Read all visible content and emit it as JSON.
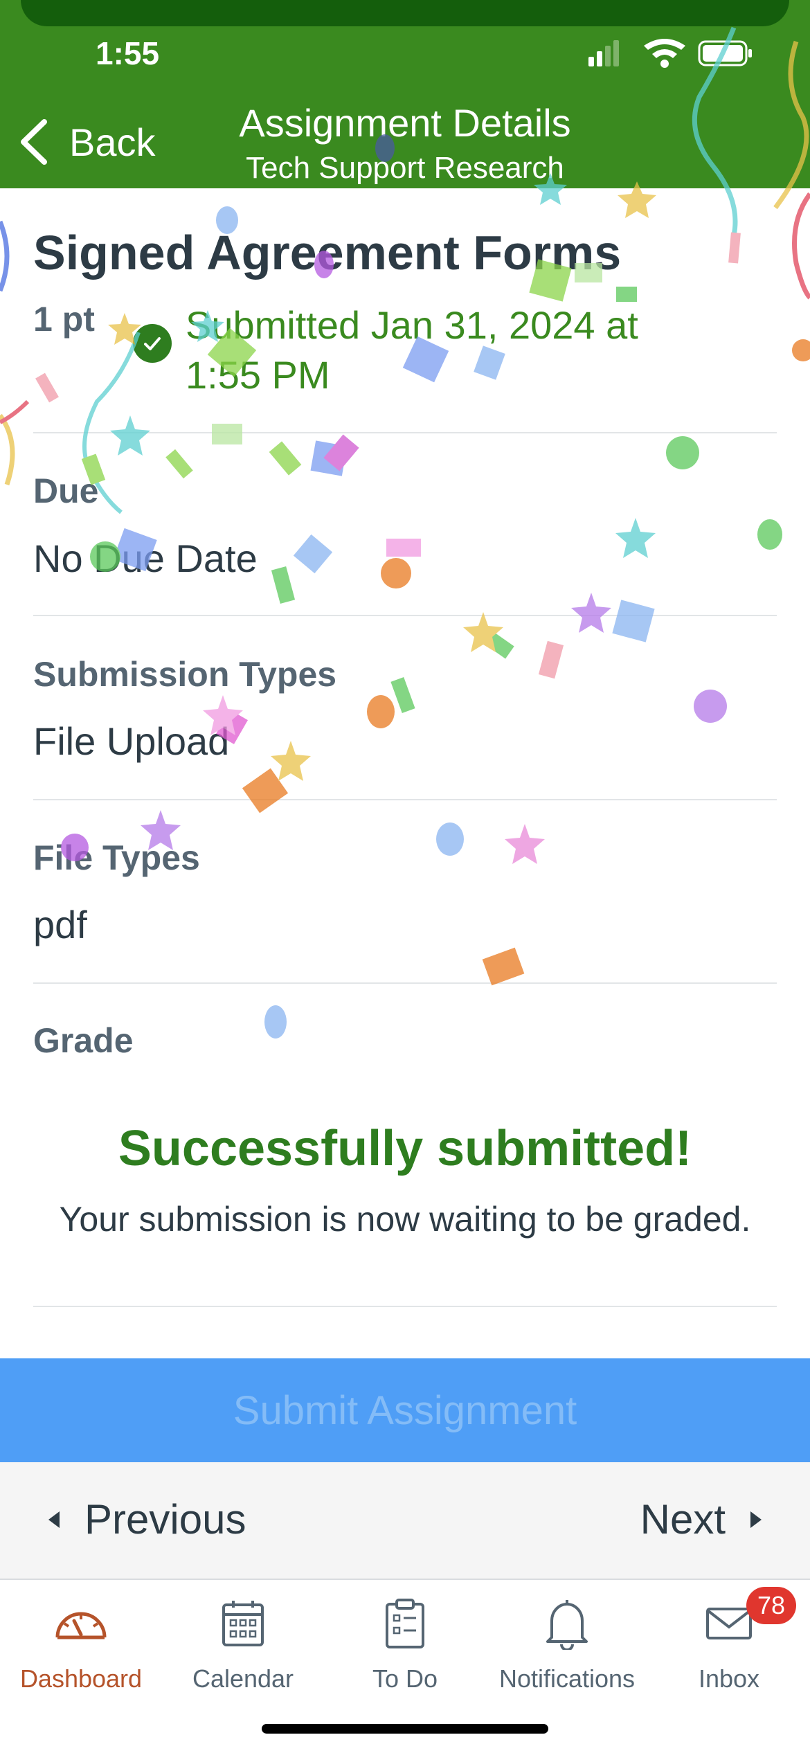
{
  "status_bar": {
    "time": "1:55"
  },
  "header": {
    "back_label": "Back",
    "title": "Assignment Details",
    "subtitle": "Tech Support Research"
  },
  "assignment": {
    "title": "Signed Agreement Forms",
    "points": "1 pt",
    "submitted_status": "Submitted Jan 31, 2024 at 1:55 PM"
  },
  "details": {
    "due_label": "Due",
    "due_value": "No Due Date",
    "submission_types_label": "Submission Types",
    "submission_types_value": "File Upload",
    "file_types_label": "File Types",
    "file_types_value": "pdf",
    "grade_label": "Grade"
  },
  "success": {
    "title": "Successfully submitted!",
    "message": "Your submission is now waiting to be graded."
  },
  "submit_button": {
    "label": "Submit Assignment"
  },
  "pager": {
    "previous_label": "Previous",
    "next_label": "Next"
  },
  "tabbar": {
    "items": [
      {
        "label": "Dashboard",
        "icon": "dashboard-gauge-icon",
        "active": true
      },
      {
        "label": "Calendar",
        "icon": "calendar-icon",
        "active": false
      },
      {
        "label": "To Do",
        "icon": "todo-clipboard-icon",
        "active": false
      },
      {
        "label": "Notifications",
        "icon": "bell-icon",
        "active": false
      },
      {
        "label": "Inbox",
        "icon": "envelope-icon",
        "active": false
      }
    ],
    "inbox_badge": "78"
  },
  "colors": {
    "header_green": "#3a8a1f",
    "success_green": "#2e7d1f",
    "submit_blue": "#4f9ef6",
    "active_tab": "#b5532a",
    "badge_red": "#e0362e"
  }
}
